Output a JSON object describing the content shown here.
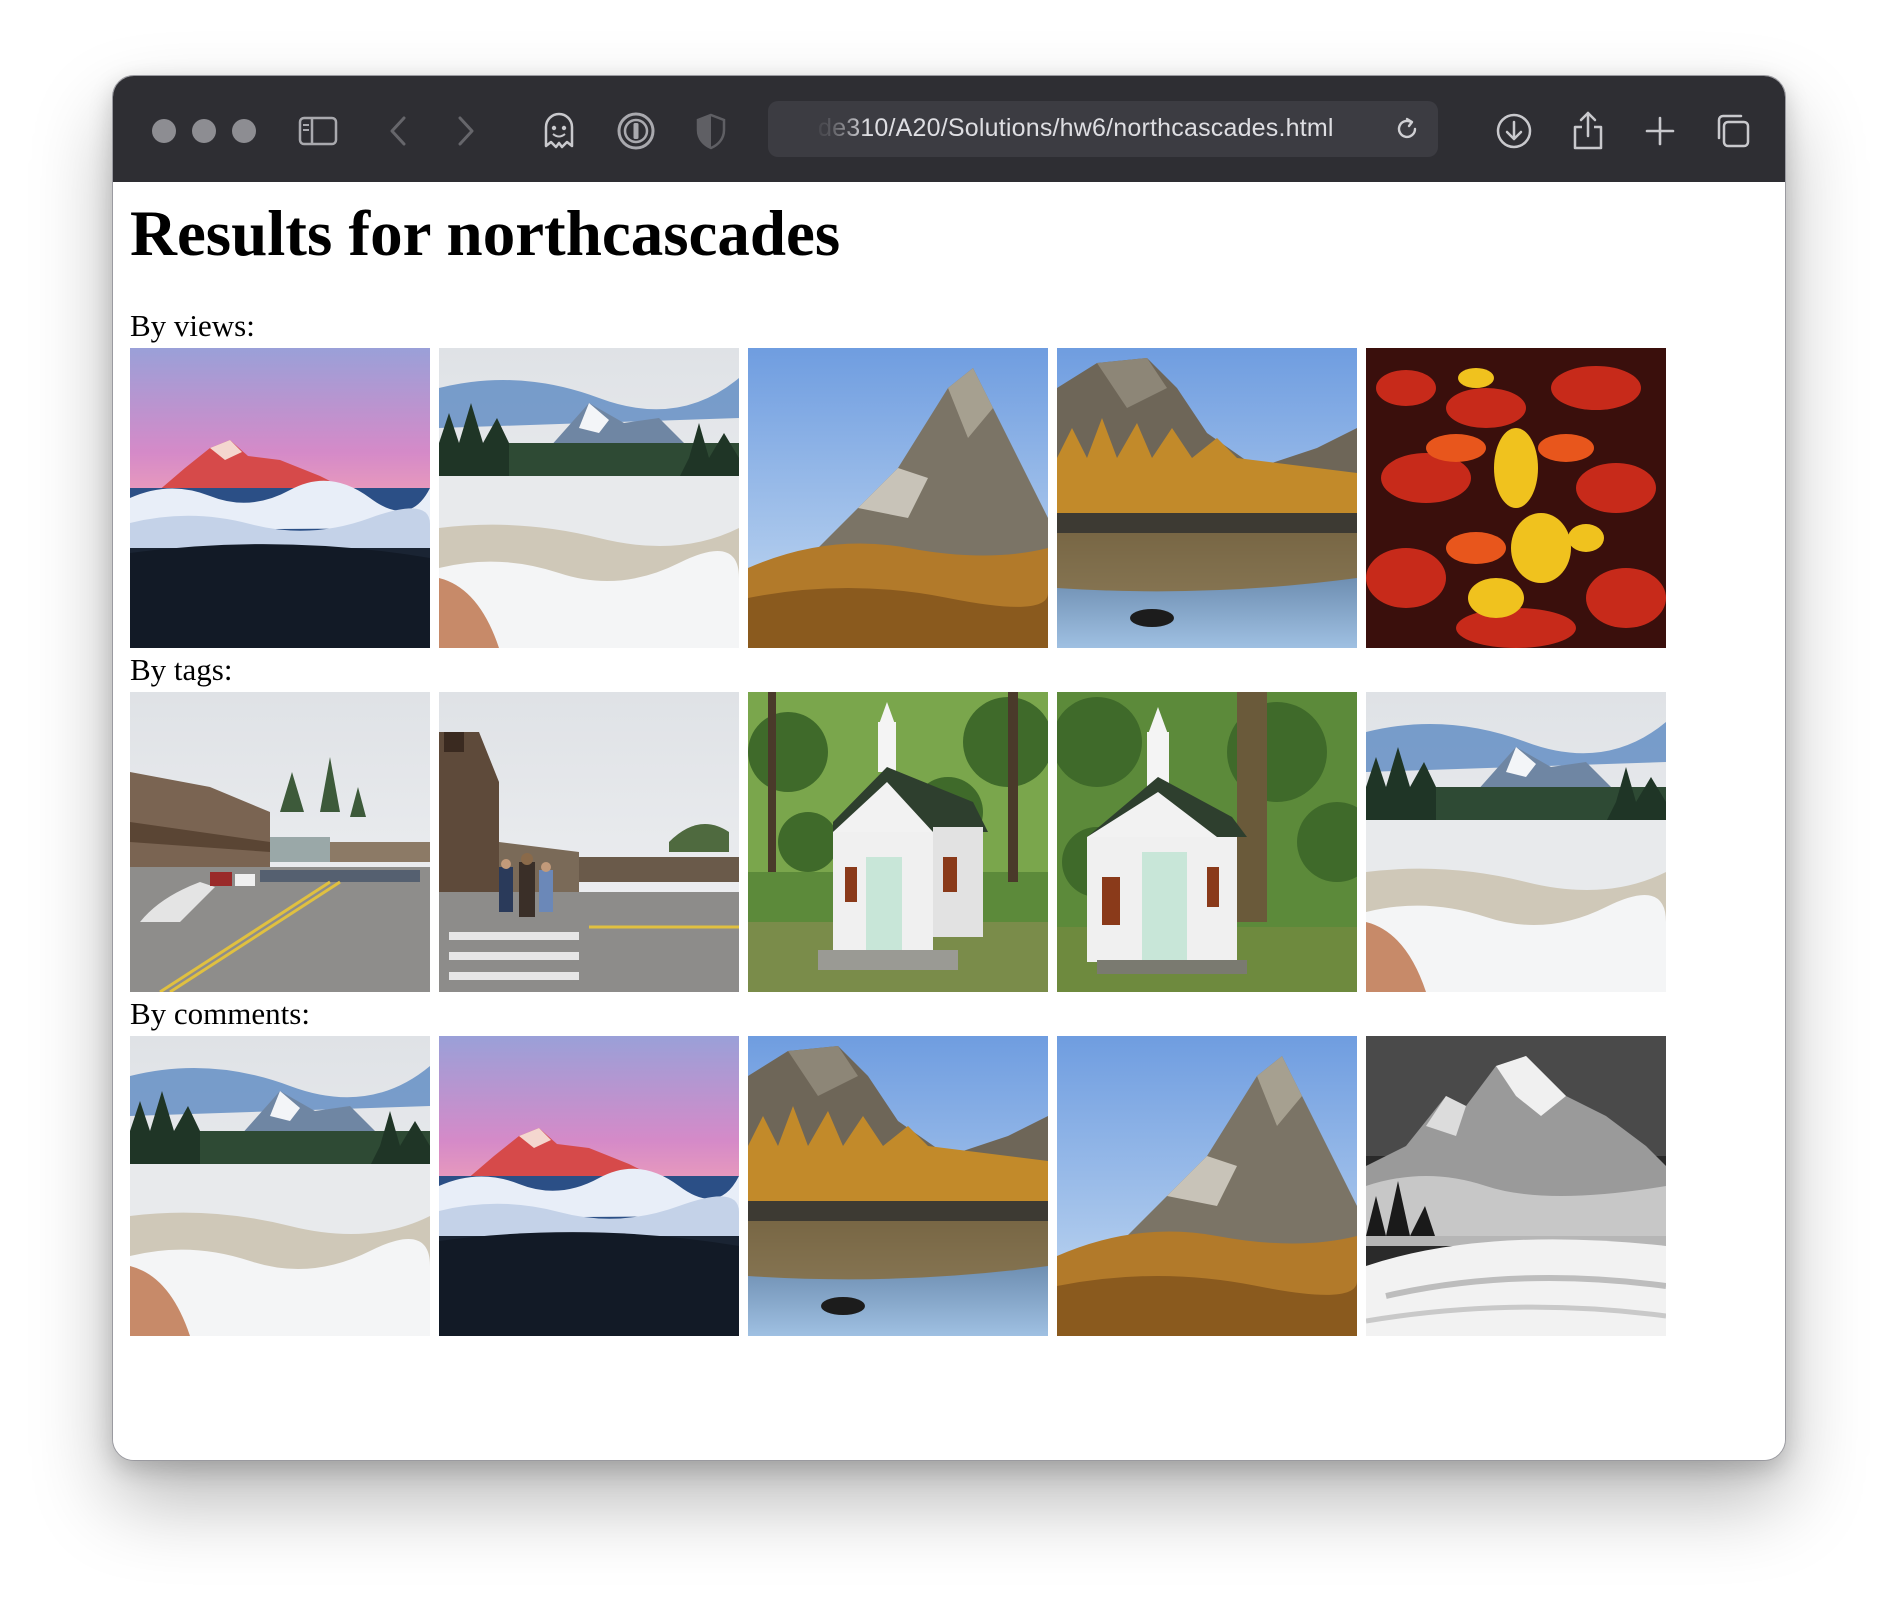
{
  "browser": {
    "url": "de310/A20/Solutions/hw6/northcascades.html",
    "icons": [
      "sidebar-icon",
      "back-icon",
      "forward-icon",
      "ghostery-icon",
      "1password-icon",
      "shield-icon",
      "reload-icon",
      "download-icon",
      "share-icon",
      "new-tab-icon",
      "tabs-overview-icon"
    ]
  },
  "page": {
    "title": "Results for northcascades",
    "sections": [
      {
        "label": "By views:",
        "images": [
          "alpenglow-peak",
          "snowy-lake-shuksan",
          "peak-larches",
          "larch-lake-reflection",
          "red-yellow-foliage"
        ]
      },
      {
        "label": "By tags:",
        "images": [
          "western-town-street",
          "town-crosswalk",
          "white-chapel",
          "white-chapel-close",
          "snowy-lake-shuksan"
        ]
      },
      {
        "label": "By comments:",
        "images": [
          "snowy-lake-shuksan",
          "alpenglow-peak",
          "larch-lake-reflection",
          "peak-larches",
          "bw-snowy-mountain"
        ]
      }
    ]
  },
  "colors": {
    "toolbar": "#2e2e33",
    "url_bar": "#3c3c42",
    "traffic_light": "#8d8d92",
    "icon": "#a9a9ae"
  }
}
